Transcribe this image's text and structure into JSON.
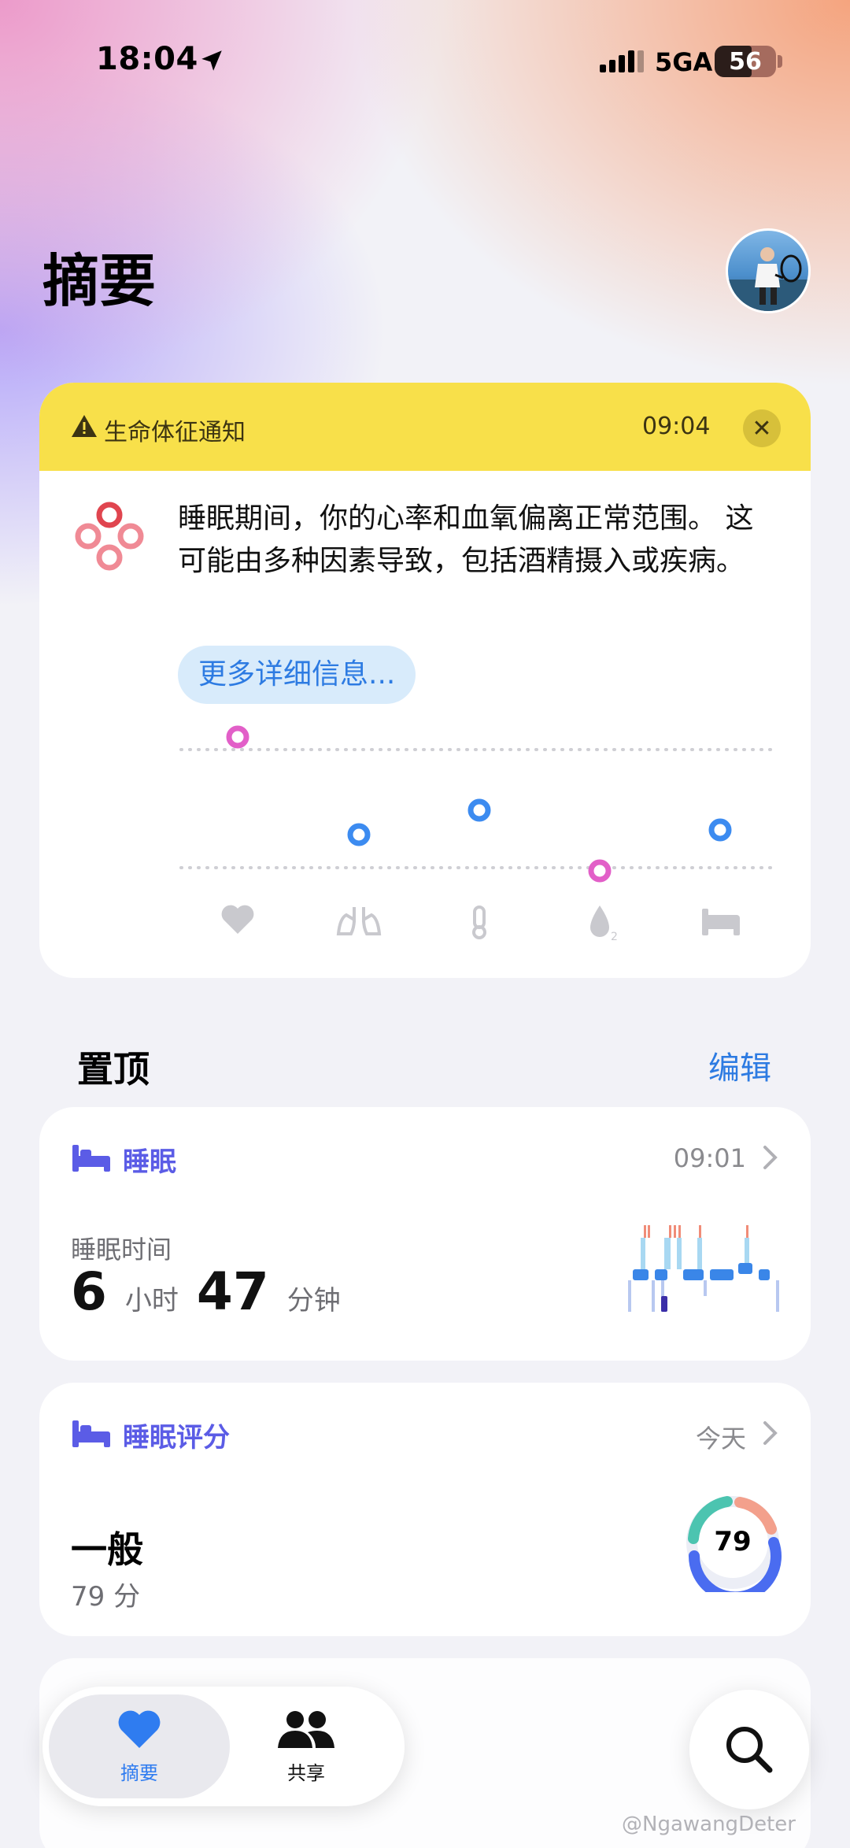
{
  "status_bar": {
    "time": "18:04",
    "network": "5GA",
    "battery": "56"
  },
  "header": {
    "title": "摘要"
  },
  "notification": {
    "label": "生命体征通知",
    "time": "09:04",
    "message": "睡眠期间，你的心率和血氧偏离正常范围。 这可能由多种因素导致，包括酒精摄入或疾病。",
    "more_button": "更多详细信息...",
    "colors": {
      "header_bg": "#f8e04a",
      "out_of_range": "#e25fc8",
      "in_range": "#3c8bf0"
    },
    "vitals_icons": [
      "heart-icon",
      "lungs-icon",
      "thermometer-icon",
      "blood-oxygen-icon",
      "bed-icon"
    ]
  },
  "pinned": {
    "title": "置顶",
    "edit": "编辑",
    "sleep": {
      "label": "睡眠",
      "time": "09:01",
      "sub_label": "睡眠时间",
      "hours": "6",
      "hours_unit": "小时",
      "minutes": "47",
      "minutes_unit": "分钟"
    },
    "sleep_score": {
      "label": "睡眠评分",
      "date": "今天",
      "level": "一般",
      "score_text": "79 分",
      "score": "79"
    }
  },
  "tabbar": {
    "summary": "摘要",
    "sharing": "共享"
  },
  "watermark": "@NgawangDeter"
}
